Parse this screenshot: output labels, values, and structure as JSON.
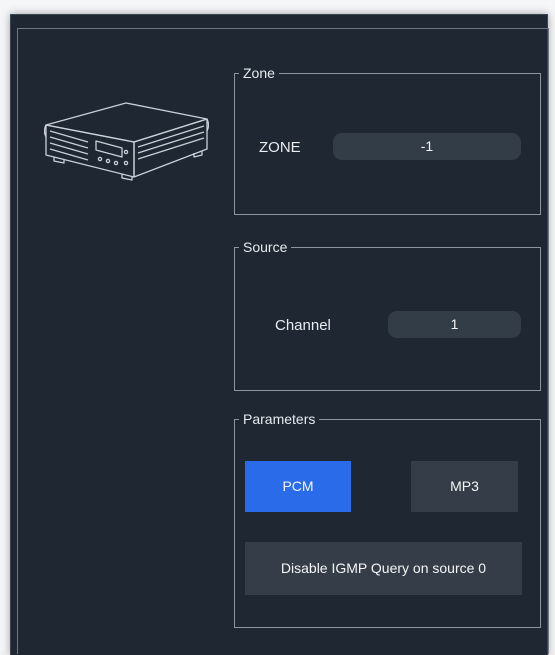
{
  "zone_group": {
    "legend": "Zone",
    "field_label": "ZONE",
    "value": "-1"
  },
  "source_group": {
    "legend": "Source",
    "field_label": "Channel",
    "value": "1"
  },
  "params_group": {
    "legend": "Parameters",
    "pcm_label": "PCM",
    "mp3_label": "MP3",
    "pcm_selected": true,
    "igmp_label": "Disable IGMP Query on source 0"
  },
  "colors": {
    "panel_bg": "#1e2732",
    "accent_selected": "#2a6bea",
    "button_bg": "#343d48",
    "text": "#e8edf2"
  },
  "icons": {
    "device": "network-audio-device-icon"
  }
}
